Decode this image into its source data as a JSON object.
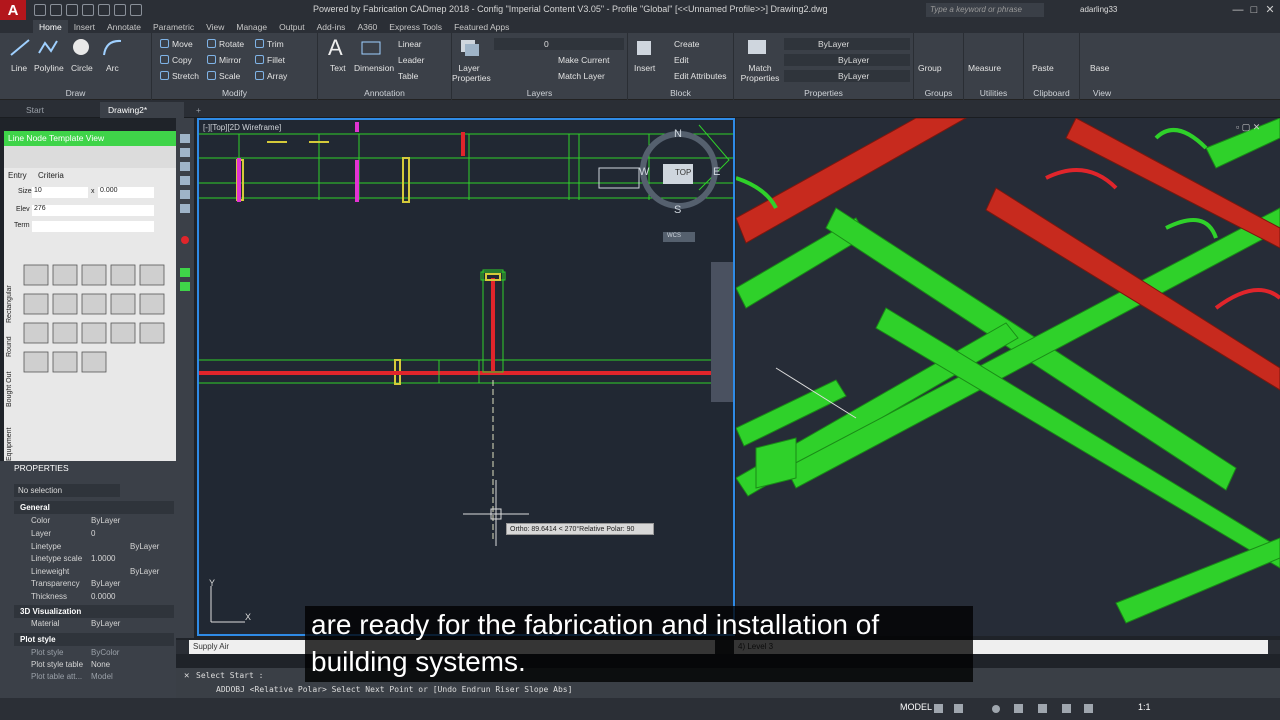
{
  "titlebar": {
    "app_logo": "A",
    "title": "Powered by Fabrication CADmep 2018 - Config \"Imperial Content V3.05\" - Profile \"Global\" [<<Unnamed Profile>>]    Drawing2.dwg",
    "search_placeholder": "Type a keyword or phrase",
    "user": "adarling33"
  },
  "menubar": {
    "tabs": [
      "Home",
      "Insert",
      "Annotate",
      "Parametric",
      "View",
      "Manage",
      "Output",
      "Add-ins",
      "A360",
      "Express Tools",
      "Featured Apps"
    ]
  },
  "ribbon": {
    "draw": {
      "label": "Draw",
      "items": [
        "Line",
        "Polyline",
        "Circle",
        "Arc"
      ]
    },
    "modify": {
      "label": "Modify",
      "items": [
        "Move",
        "Rotate",
        "Trim",
        "Copy",
        "Mirror",
        "Fillet",
        "Stretch",
        "Scale",
        "Array"
      ]
    },
    "annotation": {
      "label": "Annotation",
      "items": [
        "Text",
        "Dimension",
        "Linear",
        "Leader",
        "Table"
      ]
    },
    "layers": {
      "label": "Layers",
      "items": [
        "Layer Properties",
        "Make Current",
        "Match Layer"
      ],
      "current": "0"
    },
    "block": {
      "label": "Block",
      "items": [
        "Insert",
        "Create",
        "Edit",
        "Edit Attributes"
      ]
    },
    "properties": {
      "label": "Properties",
      "items": [
        "Match Properties"
      ],
      "color": "ByLayer",
      "linetype": "ByLayer",
      "lineweight": "ByLayer"
    },
    "groups": {
      "label": "Groups",
      "items": [
        "Group"
      ]
    },
    "utilities": {
      "label": "Utilities",
      "items": [
        "Measure"
      ]
    },
    "clipboard": {
      "label": "Clipboard",
      "items": [
        "Paste"
      ]
    },
    "view": {
      "label": "View",
      "items": [
        "Base"
      ]
    }
  },
  "doctabs": {
    "start": "Start",
    "drawing": "Drawing2*"
  },
  "palette": {
    "menu": "Line  Node  Template  View",
    "tabs": [
      "Entry",
      "Criteria"
    ],
    "size_label": "Size",
    "size_w": "10",
    "size_x": "x",
    "size_h": "0.000",
    "elev_label": "Elev",
    "elev_value": "276",
    "term_label": "Term",
    "side_tabs": [
      "Rectangular",
      "Round",
      "Bought Out",
      "Equipment"
    ]
  },
  "properties": {
    "title": "PROPERTIES",
    "selection": "No selection",
    "general": {
      "title": "General",
      "rows": [
        [
          "Color",
          "ByLayer"
        ],
        [
          "Layer",
          "0"
        ],
        [
          "Linetype",
          "ByLayer"
        ],
        [
          "Linetype scale",
          "1.0000"
        ],
        [
          "Lineweight",
          "ByLayer"
        ],
        [
          "Transparency",
          "ByLayer"
        ],
        [
          "Thickness",
          "0.0000"
        ]
      ]
    },
    "viz": {
      "title": "3D Visualization",
      "rows": [
        [
          "Material",
          "ByLayer"
        ]
      ]
    },
    "plot": {
      "title": "Plot style",
      "rows": [
        [
          "Plot style",
          "ByColor"
        ],
        [
          "Plot style table",
          "None"
        ],
        [
          "Plot table att...",
          "Model"
        ]
      ]
    }
  },
  "viewport": {
    "label": "[-][Top][2D Wireframe]",
    "compass_top": "TOP",
    "compass_n": "N",
    "compass_s": "S",
    "compass_w": "W",
    "compass_e": "E",
    "wcs": "WCS",
    "tooltip": "Ortho: 89.6414 < 270°Relative Polar: 90",
    "ucs_x": "X",
    "ucs_y": "Y"
  },
  "status": {
    "layer": "Supply Air",
    "level": "4) Level 3"
  },
  "cmdline": {
    "history": "Select Start :",
    "prompt": "ADDOBJ <Relative Polar> Select Next Point or [Undo Endrun Riser Slope Abs]"
  },
  "bottombar": {
    "model": "MODEL",
    "scale": "1:1"
  },
  "subtitle": {
    "line1": "are ready for the fabrication and installation of",
    "line2": "building systems."
  },
  "colors": {
    "duct_supply": "#e0252b",
    "duct_return": "#2fd12a",
    "accent": "#2f8be6",
    "palette_header": "#3fd449"
  }
}
